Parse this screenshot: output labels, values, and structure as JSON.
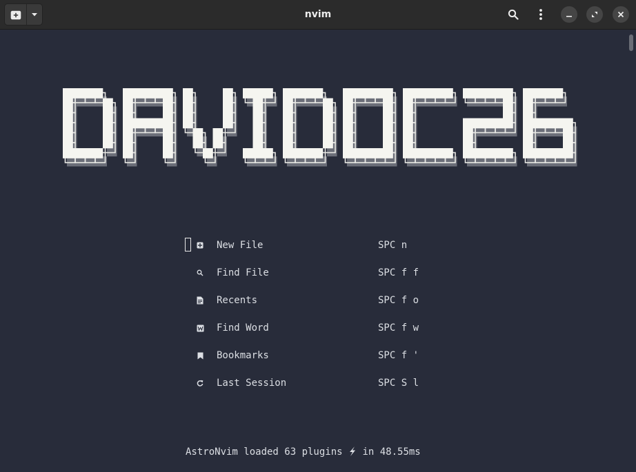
{
  "window": {
    "title": "nvim"
  },
  "titlebar": {
    "buttons": [
      {
        "name": "new-tab-icon"
      },
      {
        "name": "tab-menu-icon"
      },
      {
        "name": "search-icon"
      },
      {
        "name": "menu-kebab-icon"
      },
      {
        "name": "minimize-icon"
      },
      {
        "name": "restore-icon"
      },
      {
        "name": "close-icon"
      }
    ]
  },
  "banner": {
    "text": "DAVIDOC26"
  },
  "menu": {
    "items": [
      {
        "icon": "new-file-icon",
        "label": "New File",
        "key": "SPC n"
      },
      {
        "icon": "search-icon",
        "label": "Find File",
        "key": "SPC f f"
      },
      {
        "icon": "document-icon",
        "label": "Recents",
        "key": "SPC f o"
      },
      {
        "icon": "word-icon",
        "label": "Find Word",
        "key": "SPC f w"
      },
      {
        "icon": "bookmark-icon",
        "label": "Bookmarks",
        "key": "SPC f '"
      },
      {
        "icon": "refresh-icon",
        "label": "Last Session",
        "key": "SPC S l"
      }
    ]
  },
  "footer": {
    "text_before": "AstroNvim loaded 63 plugins ",
    "text_after": " in 48.55ms",
    "icon": "lightning-icon"
  },
  "colors": {
    "background": "#282c3a",
    "titlebar": "#2b2b2b",
    "banner_fill": "#f5f5f0",
    "banner_shadow": "#6b6e78",
    "text": "#dcdfe4"
  }
}
